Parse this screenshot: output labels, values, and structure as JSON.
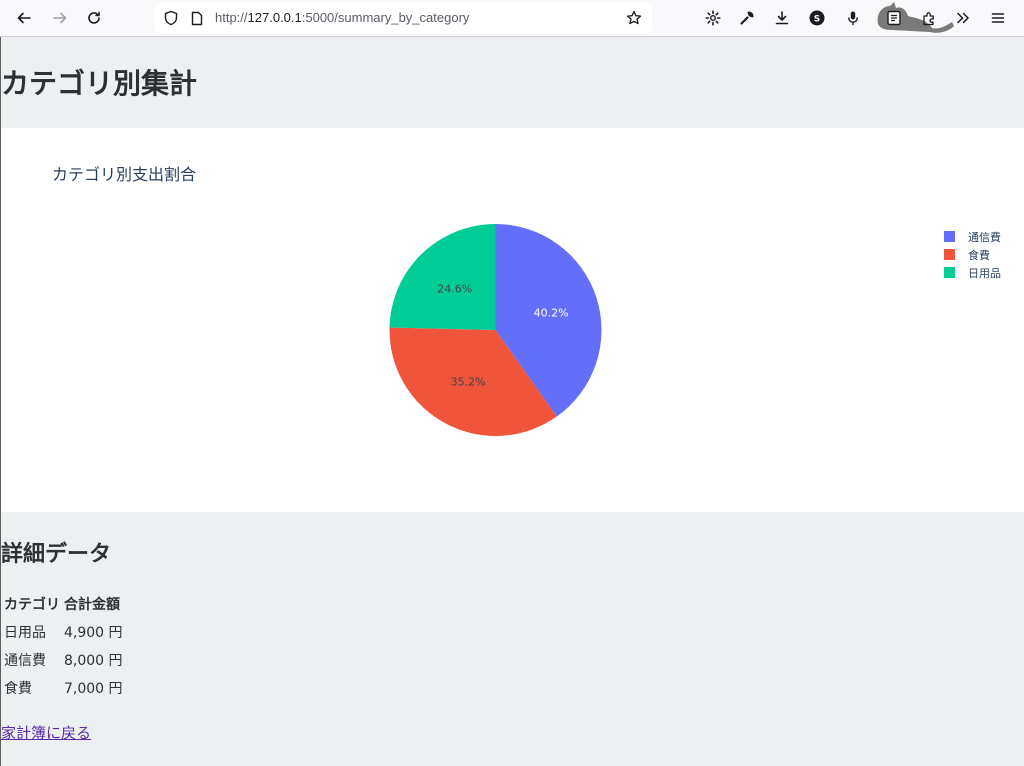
{
  "browser": {
    "url_prefix": "http://",
    "url_host": "127.0.0.1",
    "url_rest": ":5000/summary_by_category",
    "icons": [
      "back-arrow-icon",
      "forward-arrow-icon",
      "reload-icon",
      "shield-icon",
      "page-icon",
      "star-icon",
      "gear-icon",
      "wrench-icon",
      "download-icon",
      "s-badge-icon",
      "microphone-icon",
      "reader-icon",
      "extensions-icon",
      "overflow-chevrons-icon",
      "menu-icon"
    ]
  },
  "page": {
    "title": "カテゴリ別集計"
  },
  "chart_data": {
    "type": "pie",
    "title": "カテゴリ別支出割合",
    "slices": [
      {
        "label": "通信費",
        "value": 8000,
        "percent_text": "40.2%",
        "color": "#636efa"
      },
      {
        "label": "食費",
        "value": 7000,
        "percent_text": "35.2%",
        "color": "#ef553b"
      },
      {
        "label": "日用品",
        "value": 4900,
        "percent_text": "24.6%",
        "color": "#00cc96"
      }
    ],
    "legend": [
      "通信費",
      "食費",
      "日用品"
    ],
    "legend_position": "top-right",
    "direction": "clockwise",
    "start": "top"
  },
  "details": {
    "title": "詳細データ",
    "columns": [
      "カテゴリ",
      "合計金額"
    ],
    "rows": [
      [
        "日用品",
        "4,900 円"
      ],
      [
        "通信費",
        "8,000 円"
      ],
      [
        "食費",
        "7,000 円"
      ]
    ]
  },
  "back_link": "家計簿に戻る",
  "colors": {
    "page_bg": "#edf0f1",
    "chart_bg": "#ffffff",
    "text": "#2c3135",
    "link": "#5a2aa5"
  }
}
